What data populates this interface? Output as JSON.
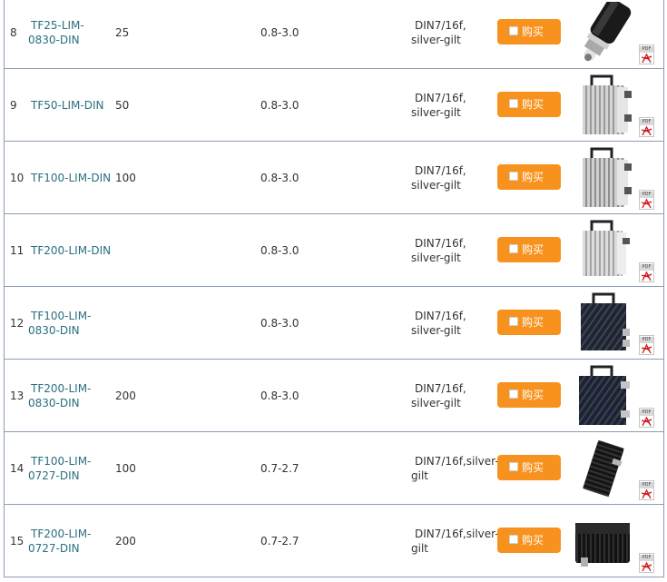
{
  "buy_label": "购买",
  "pdf_tag": "PDF",
  "accent": "#f7921e",
  "link_color": "#2a6f80",
  "rows": [
    {
      "num": "8",
      "model1": "TF25-LIM-",
      "model2": "0830-DIN",
      "power": "25",
      "freq": "0.8-3.0",
      "conn1": "DIN7/16f,",
      "conn2": "silver-gilt",
      "image": "cylindrical-terminator-image"
    },
    {
      "num": "9",
      "model1": "TF50-LIM-DIN",
      "model2": "",
      "power": "50",
      "freq": "0.8-3.0",
      "conn1": "DIN7/16f,",
      "conn2": "silver-gilt",
      "image": "silver-heatsink-terminator-image"
    },
    {
      "num": "10",
      "model1": "TF100-LIM-DIN",
      "model2": "",
      "power": "100",
      "freq": "0.8-3.0",
      "conn1": "DIN7/16f,",
      "conn2": "silver-gilt",
      "image": "silver-heatsink-terminator-image"
    },
    {
      "num": "11",
      "model1": "TF200-LIM-DIN",
      "model2": "",
      "power": "",
      "freq": "0.8-3.0",
      "conn1": "DIN7/16f,",
      "conn2": "silver-gilt",
      "image": "silver-heatsink-terminator-image"
    },
    {
      "num": "12",
      "model1": "TF100-LIM-",
      "model2": "0830-DIN",
      "power": "",
      "freq": "0.8-3.0",
      "conn1": "DIN7/16f,",
      "conn2": "silver-gilt",
      "image": "black-heatsink-terminator-image"
    },
    {
      "num": "13",
      "model1": "TF200-LIM-",
      "model2": "0830-DIN",
      "power": "200",
      "freq": "0.8-3.0",
      "conn1": "DIN7/16f,",
      "conn2": "silver-gilt",
      "image": "black-heatsink-terminator-image"
    },
    {
      "num": "14",
      "model1": "TF100-LIM-",
      "model2": "0727-DIN",
      "power": "100",
      "freq": "0.7-2.7",
      "conn1": "DIN7/16f,silver-",
      "conn2": "gilt",
      "image": "black-compact-terminator-image"
    },
    {
      "num": "15",
      "model1": "TF200-LIM-",
      "model2": "0727-DIN",
      "power": "200",
      "freq": "0.7-2.7",
      "conn1": "DIN7/16f,silver-",
      "conn2": "gilt",
      "image": "black-box-terminator-image"
    }
  ]
}
